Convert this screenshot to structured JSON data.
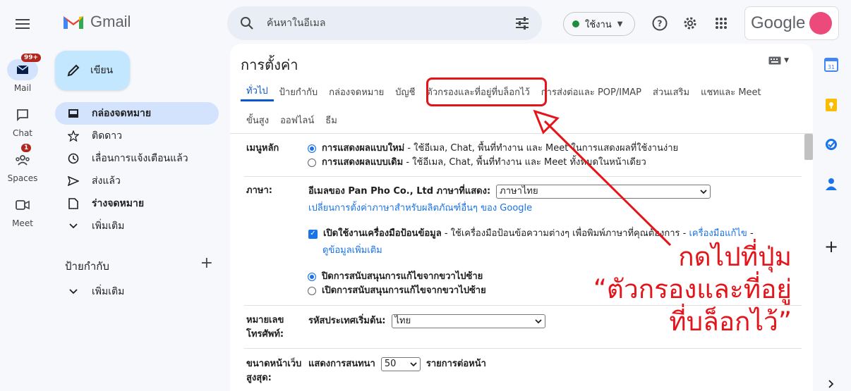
{
  "app": {
    "name": "Gmail"
  },
  "search": {
    "placeholder": "ค้นหาในอีเมล"
  },
  "status": {
    "label": "ใช้งาน"
  },
  "account": {
    "brand": "Google"
  },
  "rail": {
    "mail": {
      "label": "Mail",
      "badge": "99+"
    },
    "chat": {
      "label": "Chat"
    },
    "spaces": {
      "label": "Spaces",
      "badge": "1"
    },
    "meet": {
      "label": "Meet"
    }
  },
  "nav": {
    "compose": "เขียน",
    "items": [
      {
        "label": "กล่องจดหมาย",
        "icon": "inbox-icon"
      },
      {
        "label": "ติดดาว",
        "icon": "star-icon"
      },
      {
        "label": "เลื่อนการแจ้งเตือนแล้ว",
        "icon": "clock-icon"
      },
      {
        "label": "ส่งแล้ว",
        "icon": "send-icon"
      },
      {
        "label": "ร่างจดหมาย",
        "icon": "draft-icon"
      },
      {
        "label": "เพิ่มเติม",
        "icon": "chevron-down-icon"
      }
    ],
    "labels_header": "ป้ายกำกับ",
    "labels_more": "เพิ่มเติม"
  },
  "settings": {
    "title": "การตั้งค่า",
    "tabs_row1": [
      "ทั่วไป",
      "ป้ายกำกับ",
      "กล่องจดหมาย",
      "บัญชี",
      "ตัวกรองและที่อยู่ที่บล็อกไว้",
      "การส่งต่อและ POP/IMAP",
      "ส่วนเสริม",
      "แชทและ Meet"
    ],
    "tabs_row2": [
      "ขั้นสูง",
      "ออฟไลน์",
      "ธีม"
    ],
    "main_menu": {
      "label": "เมนูหลัก",
      "opt1_bold": "การแสดงผลแบบใหม่",
      "opt1_rest": " - ใช้อีเมล, Chat, พื้นที่ทำงาน และ Meet ในการแสดงผลที่ใช้งานง่าย",
      "opt2_bold": "การแสดงผลแบบเดิม",
      "opt2_rest": " - ใช้อีเมล, Chat, พื้นที่ทำงาน และ Meet ทั้งหมดในหน้าเดียว"
    },
    "language": {
      "label": "ภาษา:",
      "display_label": "อีเมลของ Pan Pho Co., Ltd ภาษาที่แสดง:",
      "selected": "ภาษาไทย",
      "other_products_link": "เปลี่ยนการตั้งค่าภาษาสำหรับผลิตภัณฑ์อื่นๆ ของ Google",
      "input_tools_bold": "เปิดใช้งานเครื่องมือป้อนข้อมูล",
      "input_tools_rest": " - ใช้เครื่องมือป้อนข้อความต่างๆ เพื่อพิมพ์ภาษาที่คุณต้องการ - ",
      "input_tools_link": "เครื่องมือแก้ไข",
      "input_tools_tail": " -",
      "more_info_link": "ดูข้อมูลเพิ่มเติม",
      "rtl_off": "ปิดการสนับสนุนการแก้ไขจากขวาไปซ้าย",
      "rtl_on": "เปิดการสนับสนุนการแก้ไขจากขวาไปซ้าย"
    },
    "phone": {
      "label_line1": "หมายเลข",
      "label_line2": "โทรศัพท์:",
      "country_label": "รหัสประเทศเริ่มต้น:",
      "selected": "ไทย"
    },
    "page_size": {
      "label_line1": "ขนาดหน้าเว็บ",
      "label_line2": "สูงสุด:",
      "prefix": "แสดงการสนทนา",
      "value": "50",
      "suffix": "รายการต่อหน้า"
    }
  },
  "annotation": {
    "line1": "กดไปที่ปุ่ม",
    "line2": "“ตัวกรองและที่อยู่",
    "line3": "ที่บล็อกไว้”",
    "color": "#e4141a"
  }
}
